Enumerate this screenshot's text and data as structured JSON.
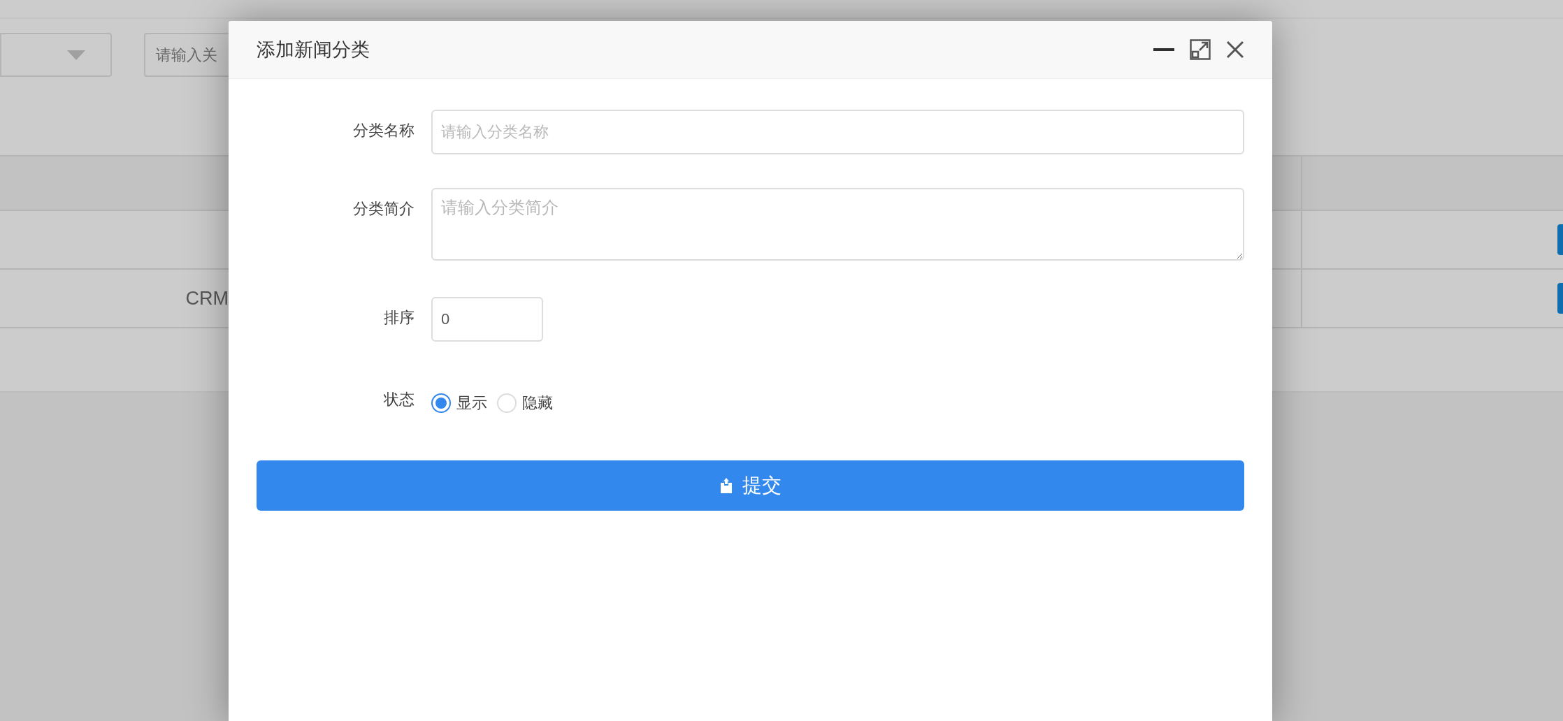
{
  "background": {
    "search": {
      "placeholder": "请输入关"
    },
    "table": {
      "rows": [
        {
          "has_action": true
        },
        {
          "column_1": "CRM",
          "has_action": true
        }
      ]
    }
  },
  "dialog": {
    "title": "添加新闻分类",
    "fields": [
      {
        "kind": "text",
        "label": "分类名称",
        "placeholder": "请输入分类名称"
      },
      {
        "kind": "textarea",
        "label": "分类简介",
        "placeholder": "请输入分类简介"
      },
      {
        "kind": "number",
        "label": "排序",
        "value": "0"
      },
      {
        "kind": "radio",
        "label": "状态",
        "options": [
          {
            "label": "显示",
            "selected": true
          },
          {
            "label": "隐藏",
            "selected": false
          }
        ]
      }
    ],
    "submit": "提交"
  }
}
